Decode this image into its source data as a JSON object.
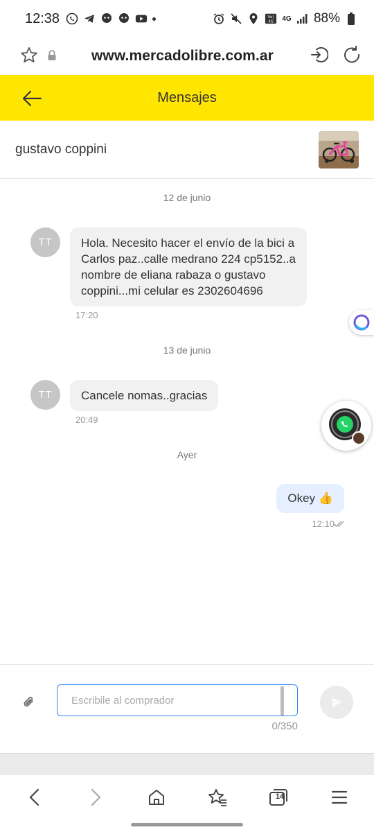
{
  "status_bar": {
    "time": "12:38",
    "network": "4G",
    "volte": "Vo) 4G",
    "battery": "88%"
  },
  "browser": {
    "url": "www.mercadolibre.com.ar",
    "tab_count": "14"
  },
  "header": {
    "title": "Mensajes"
  },
  "contact": {
    "name": "gustavo coppini"
  },
  "messages": [
    {
      "type": "date",
      "text": "12 de junio"
    },
    {
      "type": "incoming",
      "avatar": "TT",
      "lines": [
        "Hola. Necesito hacer el envío de la bici a",
        "Carlos paz..calle medrano 224 cp5152..a",
        "nombre de eliana rabaza o gustavo",
        "coppini...mi celular es 2302604696"
      ],
      "time": "17:20"
    },
    {
      "type": "date",
      "text": "13 de junio"
    },
    {
      "type": "incoming",
      "avatar": "TT",
      "lines": [
        "Cancele nomas..gracias"
      ],
      "time": "20:49"
    },
    {
      "type": "date",
      "text": "Ayer"
    },
    {
      "type": "outgoing",
      "text": "Okey 👍",
      "time": "12:10"
    }
  ],
  "compose": {
    "placeholder": "Escribile al comprador",
    "value": "",
    "counter": "0/350"
  },
  "colors": {
    "header_bg": "#ffe600",
    "accent": "#3483fa",
    "bubble_in": "#f1f1f1",
    "bubble_out": "#e5efff"
  }
}
